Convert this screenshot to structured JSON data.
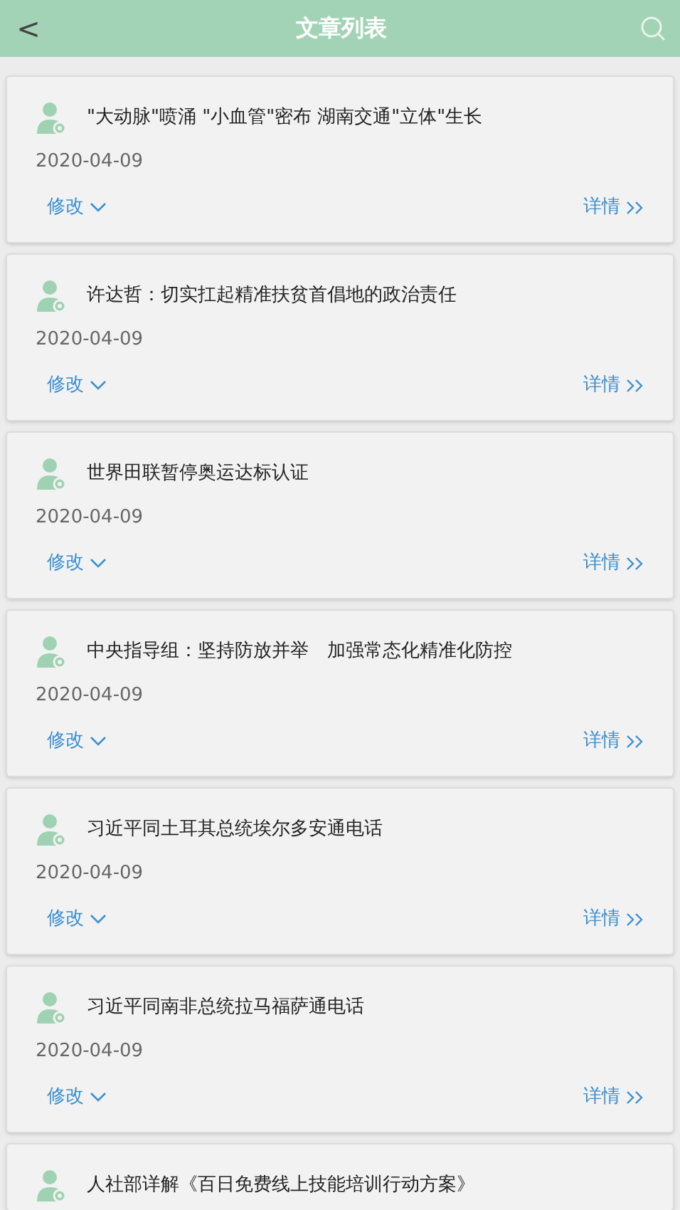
{
  "header": {
    "back": "<",
    "title": "文章列表"
  },
  "articles": [
    {
      "title": "\"大动脉\"喷涌 \"小血管\"密布 湖南交通\"立体\"生长",
      "date": "2020-04-09",
      "edit": "修改",
      "detail": "详情"
    },
    {
      "title": "许达哲：切实扛起精准扶贫首倡地的政治责任",
      "date": "2020-04-09",
      "edit": "修改",
      "detail": "详情"
    },
    {
      "title": "世界田联暂停奥运达标认证",
      "date": "2020-04-09",
      "edit": "修改",
      "detail": "详情"
    },
    {
      "title": "中央指导组：坚持防放并举　加强常态化精准化防控",
      "date": "2020-04-09",
      "edit": "修改",
      "detail": "详情"
    },
    {
      "title": "习近平同土耳其总统埃尔多安通电话",
      "date": "2020-04-09",
      "edit": "修改",
      "detail": "详情"
    },
    {
      "title": "习近平同南非总统拉马福萨通电话",
      "date": "2020-04-09",
      "edit": "修改",
      "detail": "详情"
    },
    {
      "title": "人社部详解《百日免费线上技能培训行动方案》"
    }
  ]
}
